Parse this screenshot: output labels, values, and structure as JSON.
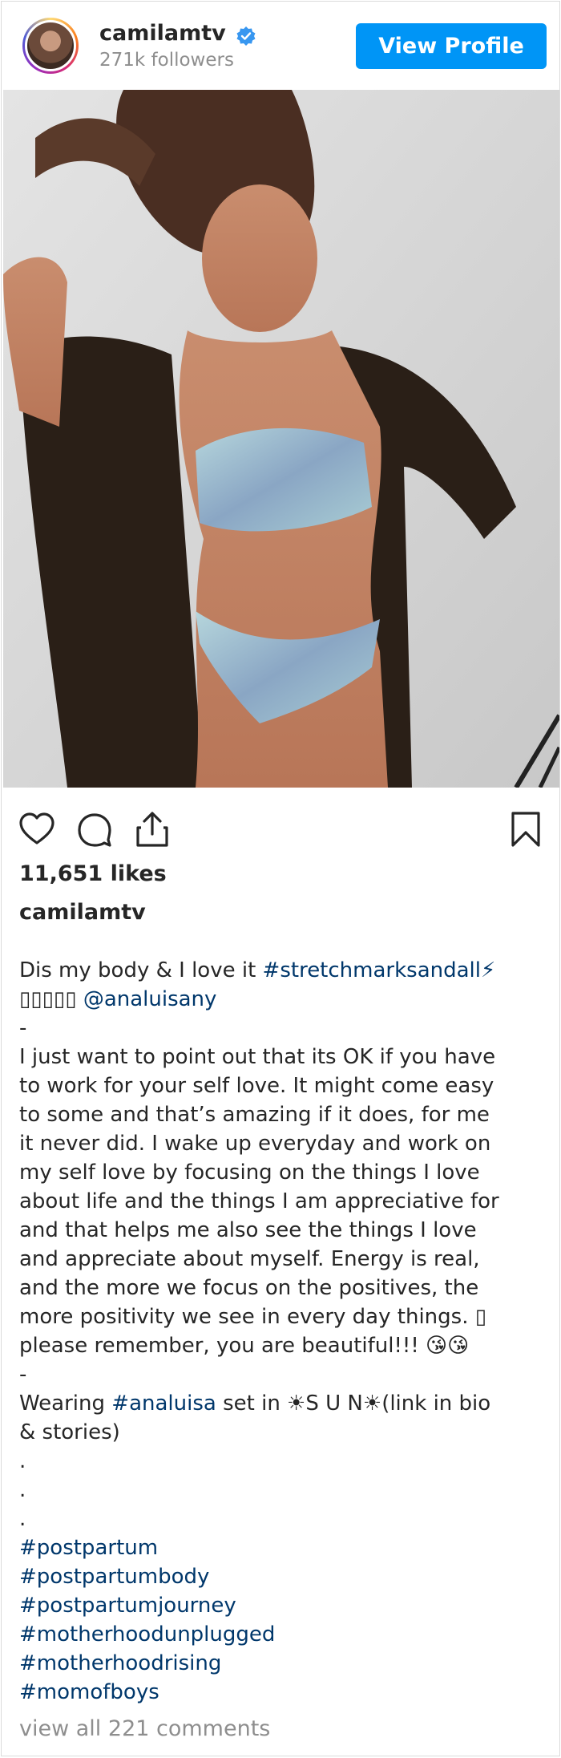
{
  "header": {
    "username": "camilamtv",
    "followers": "271k followers",
    "view_profile": "View Profile"
  },
  "colors": {
    "accent": "#0095f6",
    "link": "#00376b",
    "muted": "#8e8e8e",
    "text": "#262626"
  },
  "icons": [
    "heart-icon",
    "comment-icon",
    "share-icon",
    "bookmark-icon",
    "verified-icon"
  ],
  "post": {
    "likes": "11,651 likes",
    "caption_user": "camilamtv",
    "caption_lines": [
      [
        {
          "t": "Dis my body & I love it "
        },
        {
          "t": "#stretchmarksandall⚡",
          "tag": true
        }
      ],
      [
        {
          "t": "▯▯▯▯▯ "
        },
        {
          "t": "@analuisany",
          "tag": true
        }
      ],
      [
        {
          "t": "-"
        }
      ],
      [
        {
          "t": "I just want to point out that its OK if you have"
        }
      ],
      [
        {
          "t": "to work for your self love. It might come easy"
        }
      ],
      [
        {
          "t": "to some and that’s amazing if it does, for me"
        }
      ],
      [
        {
          "t": "it never did. I wake up everyday and work on"
        }
      ],
      [
        {
          "t": "my self love by focusing on the things I love"
        }
      ],
      [
        {
          "t": "about life and the things I am appreciative for"
        }
      ],
      [
        {
          "t": "and that helps me also see the things I love"
        }
      ],
      [
        {
          "t": "and appreciate about myself. Energy is real,"
        }
      ],
      [
        {
          "t": "and the more we focus on the positives, the"
        }
      ],
      [
        {
          "t": "more positivity we see in every day things. ▯"
        }
      ],
      [
        {
          "t": "please remember, you are beautiful!!! 😘😘"
        }
      ],
      [
        {
          "t": "-"
        }
      ],
      [
        {
          "t": "Wearing "
        },
        {
          "t": "#analuisa",
          "tag": true
        },
        {
          "t": " set in ☀S U N☀(link in bio"
        }
      ],
      [
        {
          "t": "& stories)"
        }
      ],
      [
        {
          "t": "."
        }
      ],
      [
        {
          "t": "."
        }
      ],
      [
        {
          "t": "."
        }
      ],
      [
        {
          "t": "#postpartum",
          "tag": true
        }
      ],
      [
        {
          "t": "#postpartumbody",
          "tag": true
        }
      ],
      [
        {
          "t": "#postpartumjourney",
          "tag": true
        }
      ],
      [
        {
          "t": "#motherhoodunplugged",
          "tag": true
        }
      ],
      [
        {
          "t": "#motherhoodrising",
          "tag": true
        }
      ],
      [
        {
          "t": "#momofboys",
          "tag": true
        }
      ]
    ],
    "comments_link": "view all 221 comments"
  }
}
